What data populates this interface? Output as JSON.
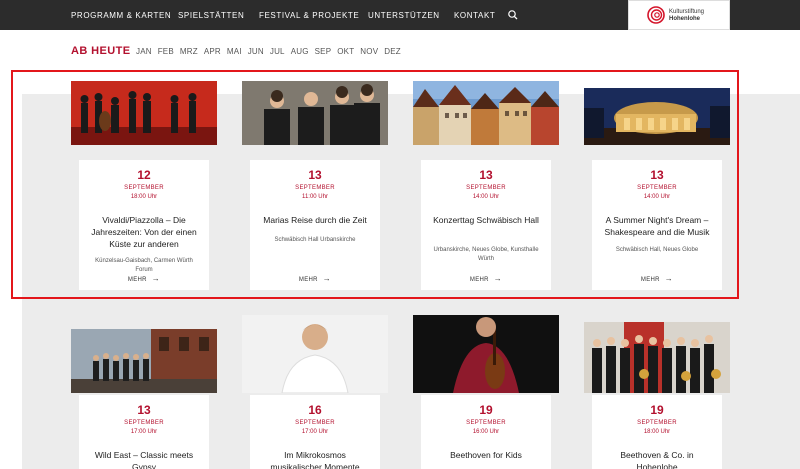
{
  "nav": {
    "items": [
      "PROGRAMM & KARTEN",
      "SPIELSTÄTTEN",
      "FESTIVAL & PROJEKTE",
      "UNTERSTÜTZEN",
      "KONTAKT"
    ]
  },
  "logo": {
    "line1": "Kulturstiftung",
    "line2": "Hohenlohe"
  },
  "filter": {
    "current": "AB HEUTE",
    "months": [
      "JAN",
      "FEB",
      "MRZ",
      "APR",
      "MAI",
      "JUN",
      "JUL",
      "AUG",
      "SEP",
      "OKT",
      "NOV",
      "DEZ"
    ]
  },
  "colors": {
    "accent": "#b3102e",
    "nav_bg": "#2c2c2c",
    "highlight": "#e3161b"
  },
  "events": [
    {
      "day": "12",
      "month": "SEPTEMBER",
      "time": "18:00 Uhr",
      "title": "Vivaldi/Piazzolla – Die Jahreszeiten: Von der einen Küste zur anderen",
      "venue": "Künzelsau-Gaisbach, Carmen Würth Forum",
      "more": "MEHR"
    },
    {
      "day": "13",
      "month": "SEPTEMBER",
      "time": "11:00 Uhr",
      "title": "Marias Reise durch die Zeit",
      "venue": "Schwäbisch Hall Urbanskirche",
      "more": "MEHR"
    },
    {
      "day": "13",
      "month": "SEPTEMBER",
      "time": "14:00 Uhr",
      "title": "Konzerttag Schwäbisch Hall",
      "venue": "Urbanskirche, Neues Globe, Kunsthalle Würth",
      "more": "MEHR"
    },
    {
      "day": "13",
      "month": "SEPTEMBER",
      "time": "14:00 Uhr",
      "title": "A Summer Night's Dream – Shakespeare and die Musik",
      "venue": "Schwäbisch Hall, Neues Globe",
      "more": "MEHR"
    },
    {
      "day": "13",
      "month": "SEPTEMBER",
      "time": "17:00 Uhr",
      "title": "Wild East – Classic meets Gypsy",
      "venue": "",
      "more": ""
    },
    {
      "day": "16",
      "month": "SEPTEMBER",
      "time": "17:00 Uhr",
      "title": "Im Mikrokosmos musikalischer Momente",
      "venue": "",
      "more": ""
    },
    {
      "day": "19",
      "month": "SEPTEMBER",
      "time": "16:00 Uhr",
      "title": "Beethoven for Kids",
      "venue": "",
      "more": ""
    },
    {
      "day": "19",
      "month": "SEPTEMBER",
      "time": "18:00 Uhr",
      "title": "Beethoven & Co. in Hohenlohe",
      "venue": "",
      "more": ""
    }
  ]
}
